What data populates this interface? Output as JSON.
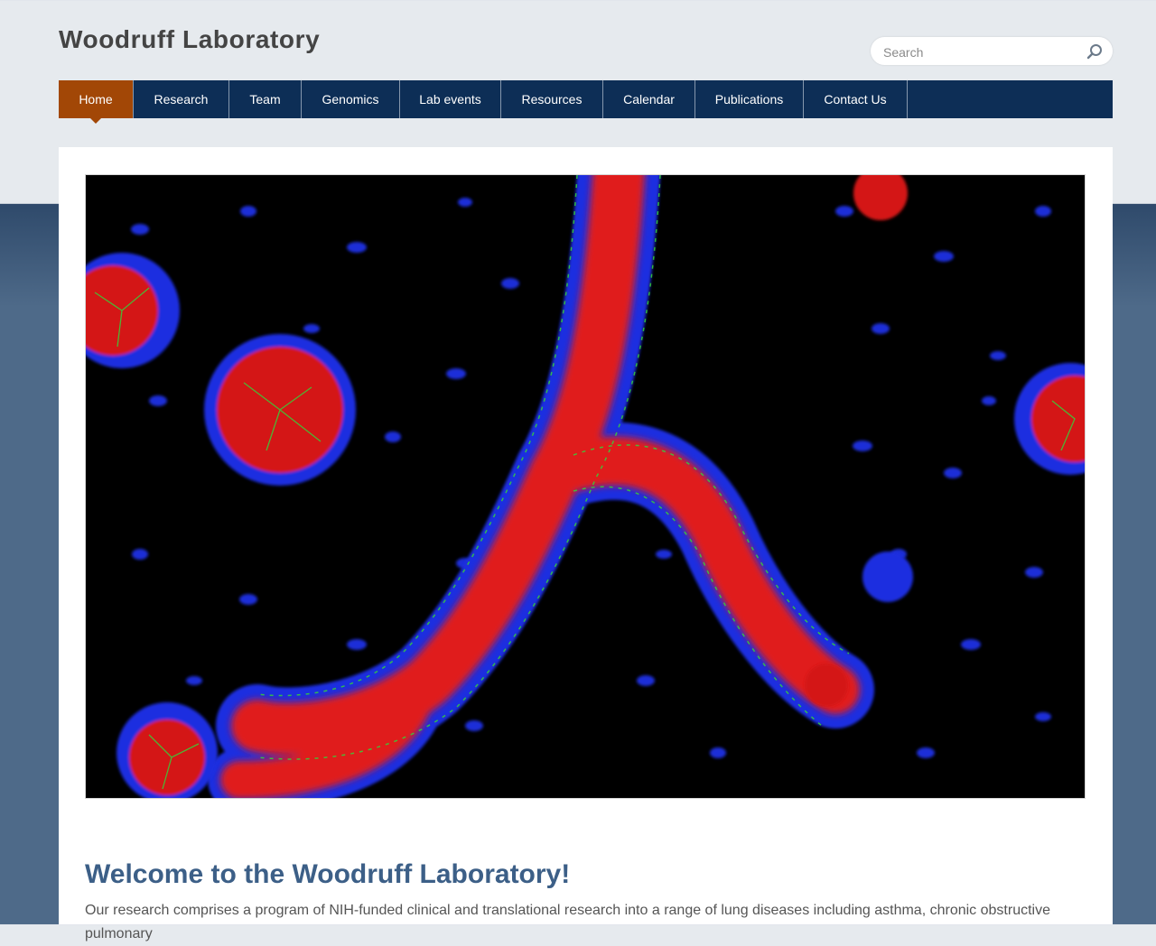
{
  "site": {
    "title": "Woodruff Laboratory"
  },
  "search": {
    "placeholder": "Search",
    "icon": "search-icon"
  },
  "nav": {
    "items": [
      {
        "label": "Home",
        "active": true
      },
      {
        "label": "Research",
        "active": false
      },
      {
        "label": "Team",
        "active": false
      },
      {
        "label": "Genomics",
        "active": false
      },
      {
        "label": "Lab events",
        "active": false
      },
      {
        "label": "Resources",
        "active": false
      },
      {
        "label": "Calendar",
        "active": false
      },
      {
        "label": "Publications",
        "active": false
      },
      {
        "label": "Contact Us",
        "active": false
      }
    ]
  },
  "colors": {
    "nav_bg": "#0d2e56",
    "nav_active": "#a24706",
    "heading": "#3c5f87",
    "page_bg_top": "#e6eaee",
    "page_bg_bottom": "#4e6a89"
  },
  "main": {
    "welcome": "Welcome to the Woodruff Laboratory!",
    "intro": "Our research comprises a program of NIH-funded clinical and translational research into a range of lung diseases including asthma, chronic obstructive pulmonary"
  }
}
